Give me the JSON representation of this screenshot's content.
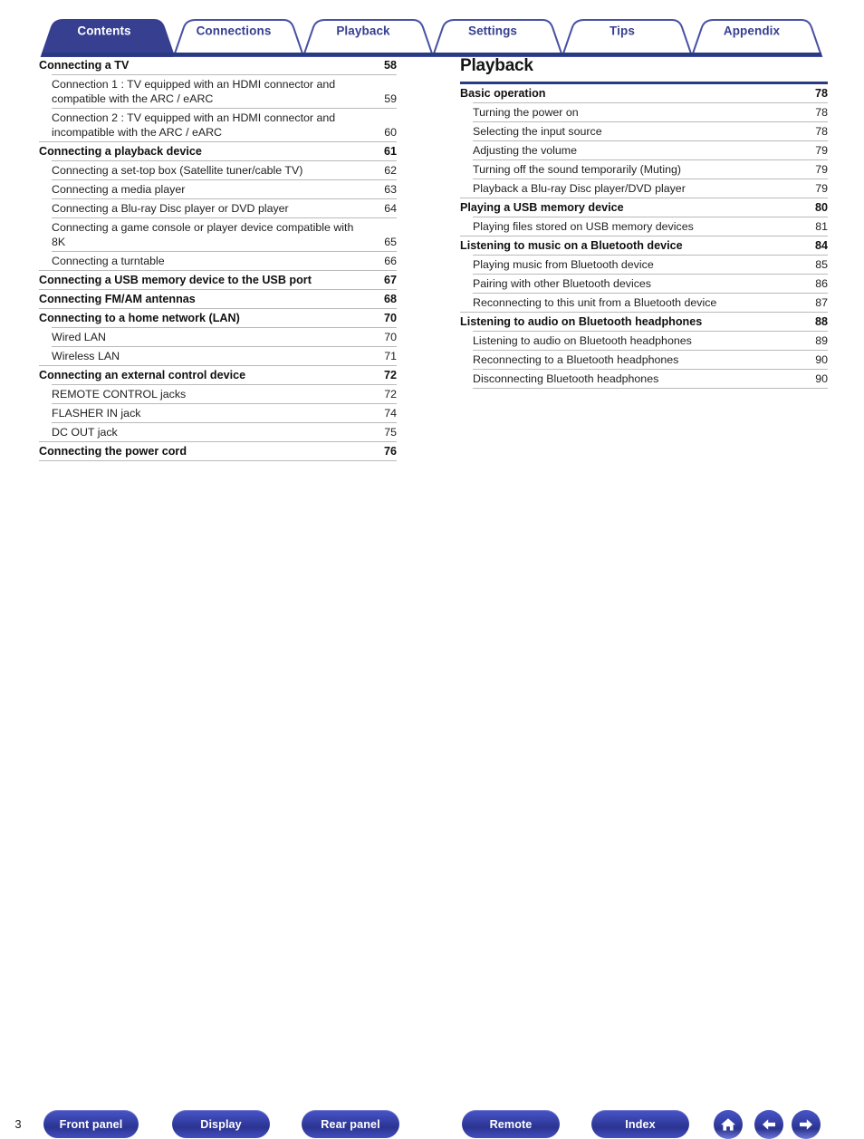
{
  "tabs": [
    {
      "label": "Contents",
      "active": true
    },
    {
      "label": "Connections",
      "active": false
    },
    {
      "label": "Playback",
      "active": false
    },
    {
      "label": "Settings",
      "active": false
    },
    {
      "label": "Tips",
      "active": false
    },
    {
      "label": "Appendix",
      "active": false
    }
  ],
  "left_column": {
    "entries": [
      {
        "level": 1,
        "text": "Connecting a TV",
        "page": "58"
      },
      {
        "level": 2,
        "text": "Connection 1 : TV equipped with an HDMI connector and compatible with the ARC / eARC",
        "page": "59"
      },
      {
        "level": 2,
        "text": "Connection 2 : TV equipped with an HDMI connector and incompatible with the ARC / eARC",
        "page": "60"
      },
      {
        "level": 1,
        "text": "Connecting a playback device",
        "page": "61"
      },
      {
        "level": 2,
        "text": "Connecting a set-top box (Satellite tuner/cable TV)",
        "page": "62"
      },
      {
        "level": 2,
        "text": "Connecting a media player",
        "page": "63"
      },
      {
        "level": 2,
        "text": "Connecting a Blu-ray Disc player or DVD player",
        "page": "64"
      },
      {
        "level": 2,
        "text": "Connecting a game console or player device compatible with 8K",
        "page": "65"
      },
      {
        "level": 2,
        "text": "Connecting a turntable",
        "page": "66"
      },
      {
        "level": 1,
        "text": "Connecting a USB memory device to the USB port",
        "page": "67"
      },
      {
        "level": 1,
        "text": "Connecting FM/AM antennas",
        "page": "68"
      },
      {
        "level": 1,
        "text": "Connecting to a home network (LAN)",
        "page": "70"
      },
      {
        "level": 2,
        "text": "Wired LAN",
        "page": "70"
      },
      {
        "level": 2,
        "text": "Wireless LAN",
        "page": "71"
      },
      {
        "level": 1,
        "text": "Connecting an external control device",
        "page": "72"
      },
      {
        "level": 2,
        "text": "REMOTE CONTROL jacks",
        "page": "72"
      },
      {
        "level": 2,
        "text": "FLASHER IN jack",
        "page": "74"
      },
      {
        "level": 2,
        "text": "DC OUT jack",
        "page": "75"
      },
      {
        "level": 1,
        "text": "Connecting the power cord",
        "page": "76"
      }
    ]
  },
  "right_column": {
    "title": "Playback",
    "entries": [
      {
        "level": 1,
        "text": "Basic operation",
        "page": "78"
      },
      {
        "level": 2,
        "text": "Turning the power on",
        "page": "78"
      },
      {
        "level": 2,
        "text": "Selecting the input source",
        "page": "78"
      },
      {
        "level": 2,
        "text": "Adjusting the volume",
        "page": "79"
      },
      {
        "level": 2,
        "text": "Turning off the sound temporarily (Muting)",
        "page": "79"
      },
      {
        "level": 2,
        "text": "Playback a Blu-ray Disc player/DVD player",
        "page": "79"
      },
      {
        "level": 1,
        "text": "Playing a USB memory device",
        "page": "80"
      },
      {
        "level": 2,
        "text": "Playing files stored on USB memory devices",
        "page": "81"
      },
      {
        "level": 1,
        "text": "Listening to music on a Bluetooth device",
        "page": "84"
      },
      {
        "level": 2,
        "text": "Playing music from Bluetooth device",
        "page": "85"
      },
      {
        "level": 2,
        "text": "Pairing with other Bluetooth devices",
        "page": "86"
      },
      {
        "level": 2,
        "text": "Reconnecting to this unit from a Bluetooth device",
        "page": "87"
      },
      {
        "level": 1,
        "text": "Listening to audio on Bluetooth headphones",
        "page": "88"
      },
      {
        "level": 2,
        "text": "Listening to audio on Bluetooth headphones",
        "page": "89"
      },
      {
        "level": 2,
        "text": "Reconnecting to a Bluetooth headphones",
        "page": "90"
      },
      {
        "level": 2,
        "text": "Disconnecting Bluetooth headphones",
        "page": "90"
      }
    ]
  },
  "footer": {
    "buttons": [
      {
        "label": "Front panel",
        "name": "front-panel-button"
      },
      {
        "label": "Display",
        "name": "display-button"
      },
      {
        "label": "Rear panel",
        "name": "rear-panel-button"
      },
      {
        "label": "Remote",
        "name": "remote-button"
      },
      {
        "label": "Index",
        "name": "index-button"
      }
    ],
    "page_number": "3",
    "icons": [
      {
        "name": "home-icon"
      },
      {
        "name": "back-arrow-icon"
      },
      {
        "name": "forward-arrow-icon"
      }
    ]
  },
  "colors": {
    "tab_blue": "#363f90",
    "rule_navy": "#2b3a80",
    "button_blue": "#3641a8"
  }
}
